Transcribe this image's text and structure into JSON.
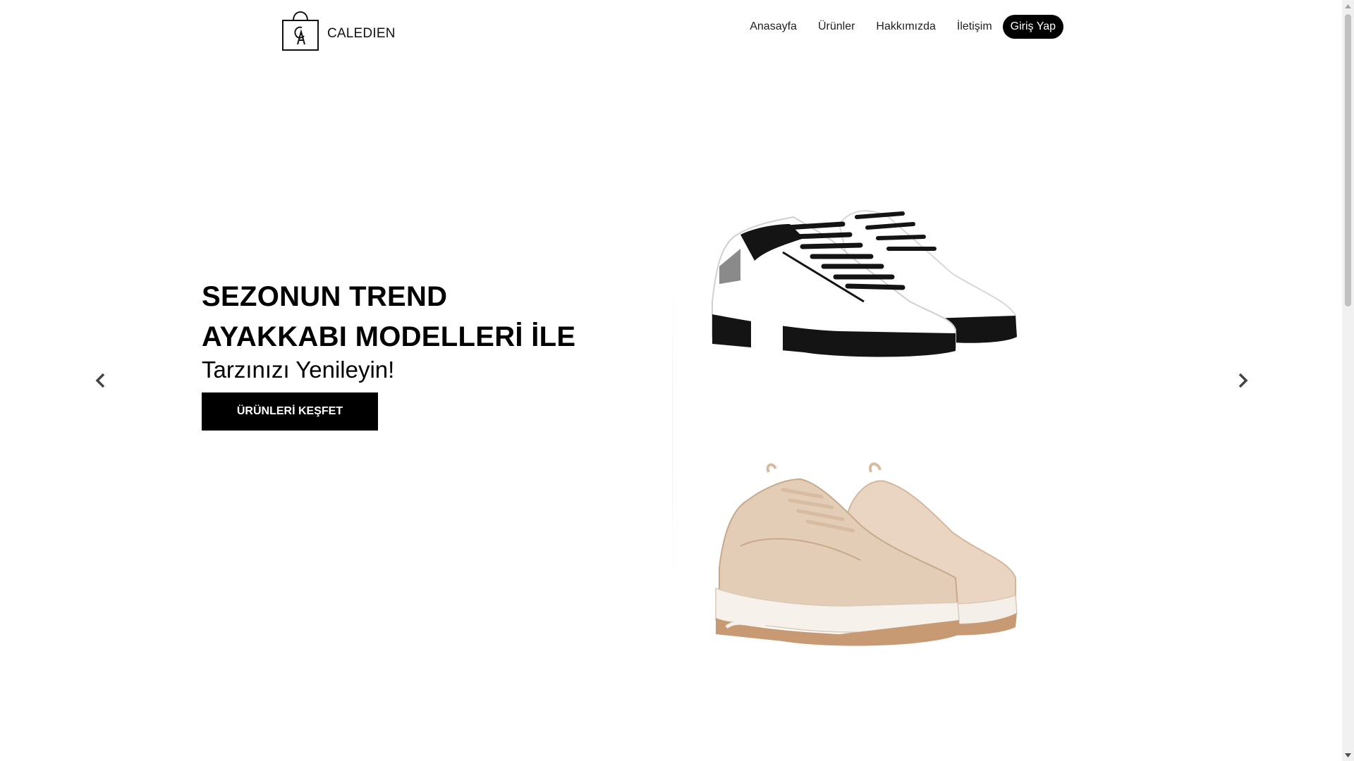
{
  "brand": {
    "name": "CALEDIEN",
    "logo_monogram": "CA"
  },
  "nav": {
    "items": [
      {
        "label": "Anasayfa"
      },
      {
        "label": "Ürünler"
      },
      {
        "label": "Hakkımızda"
      },
      {
        "label": "İletişim"
      }
    ],
    "login_label": "Giriş Yap"
  },
  "hero": {
    "title_line1": "SEZONUN TREND",
    "title_line2": "AYAKKABI MODELLERİ İLE",
    "subtitle": "Tarzınızı Yenileyin!",
    "cta_label": "ÜRÜNLERİ KEŞFET"
  },
  "carousel": {
    "prev_icon": "chevron-left-icon",
    "next_icon": "chevron-right-icon"
  },
  "images": [
    {
      "name": "white-black-sneaker",
      "colors": {
        "upper": "#ffffff",
        "sole": "#111111",
        "accent": "#8a8a8a"
      }
    },
    {
      "name": "beige-chunky-sneaker",
      "colors": {
        "upper": "#e3cdb6",
        "sole": "#f4efe8",
        "outsole": "#c89a74"
      }
    }
  ],
  "colors": {
    "primary": "#000000",
    "background": "#ffffff",
    "text": "#222222"
  }
}
